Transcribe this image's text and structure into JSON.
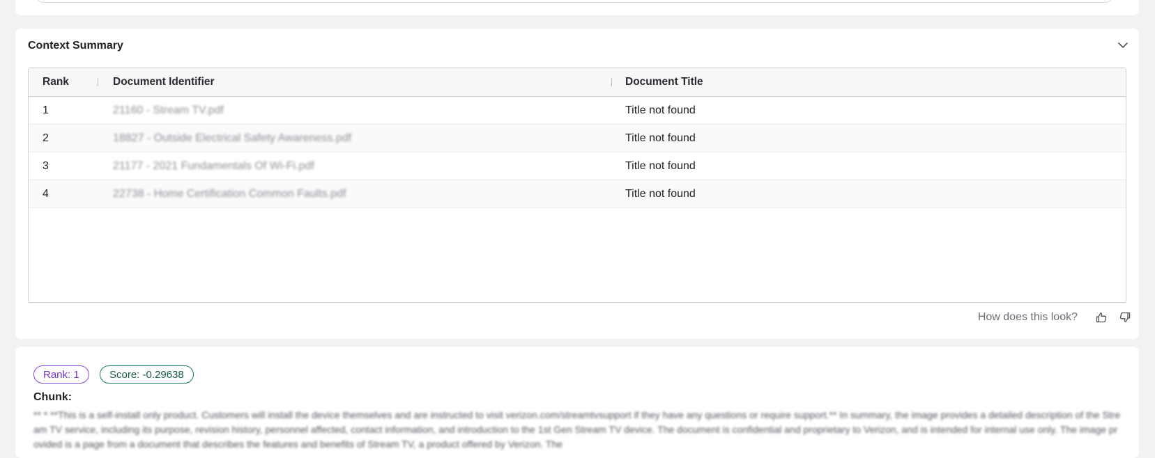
{
  "context_summary": {
    "title": "Context Summary",
    "columns": [
      "Rank",
      "Document Identifier",
      "Document Title"
    ],
    "rows": [
      {
        "rank": "1",
        "doc_id": "21160 - Stream TV.pdf",
        "title": "Title not found"
      },
      {
        "rank": "2",
        "doc_id": "18827 - Outside Electrical Safety Awareness.pdf",
        "title": "Title not found"
      },
      {
        "rank": "3",
        "doc_id": "21177 - 2021 Fundamentals Of Wi-Fi.pdf",
        "title": "Title not found"
      },
      {
        "rank": "4",
        "doc_id": "22738 - Home Certification Common Faults.pdf",
        "title": "Title not found"
      }
    ],
    "feedback_prompt": "How does this look?"
  },
  "chunk": {
    "rank_label": "Rank:  1",
    "score_label": "Score:  -0.29638",
    "chunk_label": "Chunk:",
    "text": "** * **This is a self-install only product. Customers will install the device themselves and are instructed to visit verizon.com/streamtvsupport if they have any questions or require support.** In summary, the image provides a detailed description of the Stream TV service, including its purpose, revision history, personnel affected, contact information, and introduction to the 1st Gen Stream TV device. The document is confidential and proprietary to Verizon, and is intended for internal use only. The image provided is a page from a document that describes the features and benefits of Stream TV, a product offered by Verizon. The"
  },
  "colors": {
    "rank_pill": "#8a4ad9",
    "score_pill": "#1d7d55",
    "page_bg": "#f1f2f4"
  },
  "icons": [
    "chevron-down-icon",
    "thumbs-up-icon",
    "thumbs-down-icon"
  ]
}
